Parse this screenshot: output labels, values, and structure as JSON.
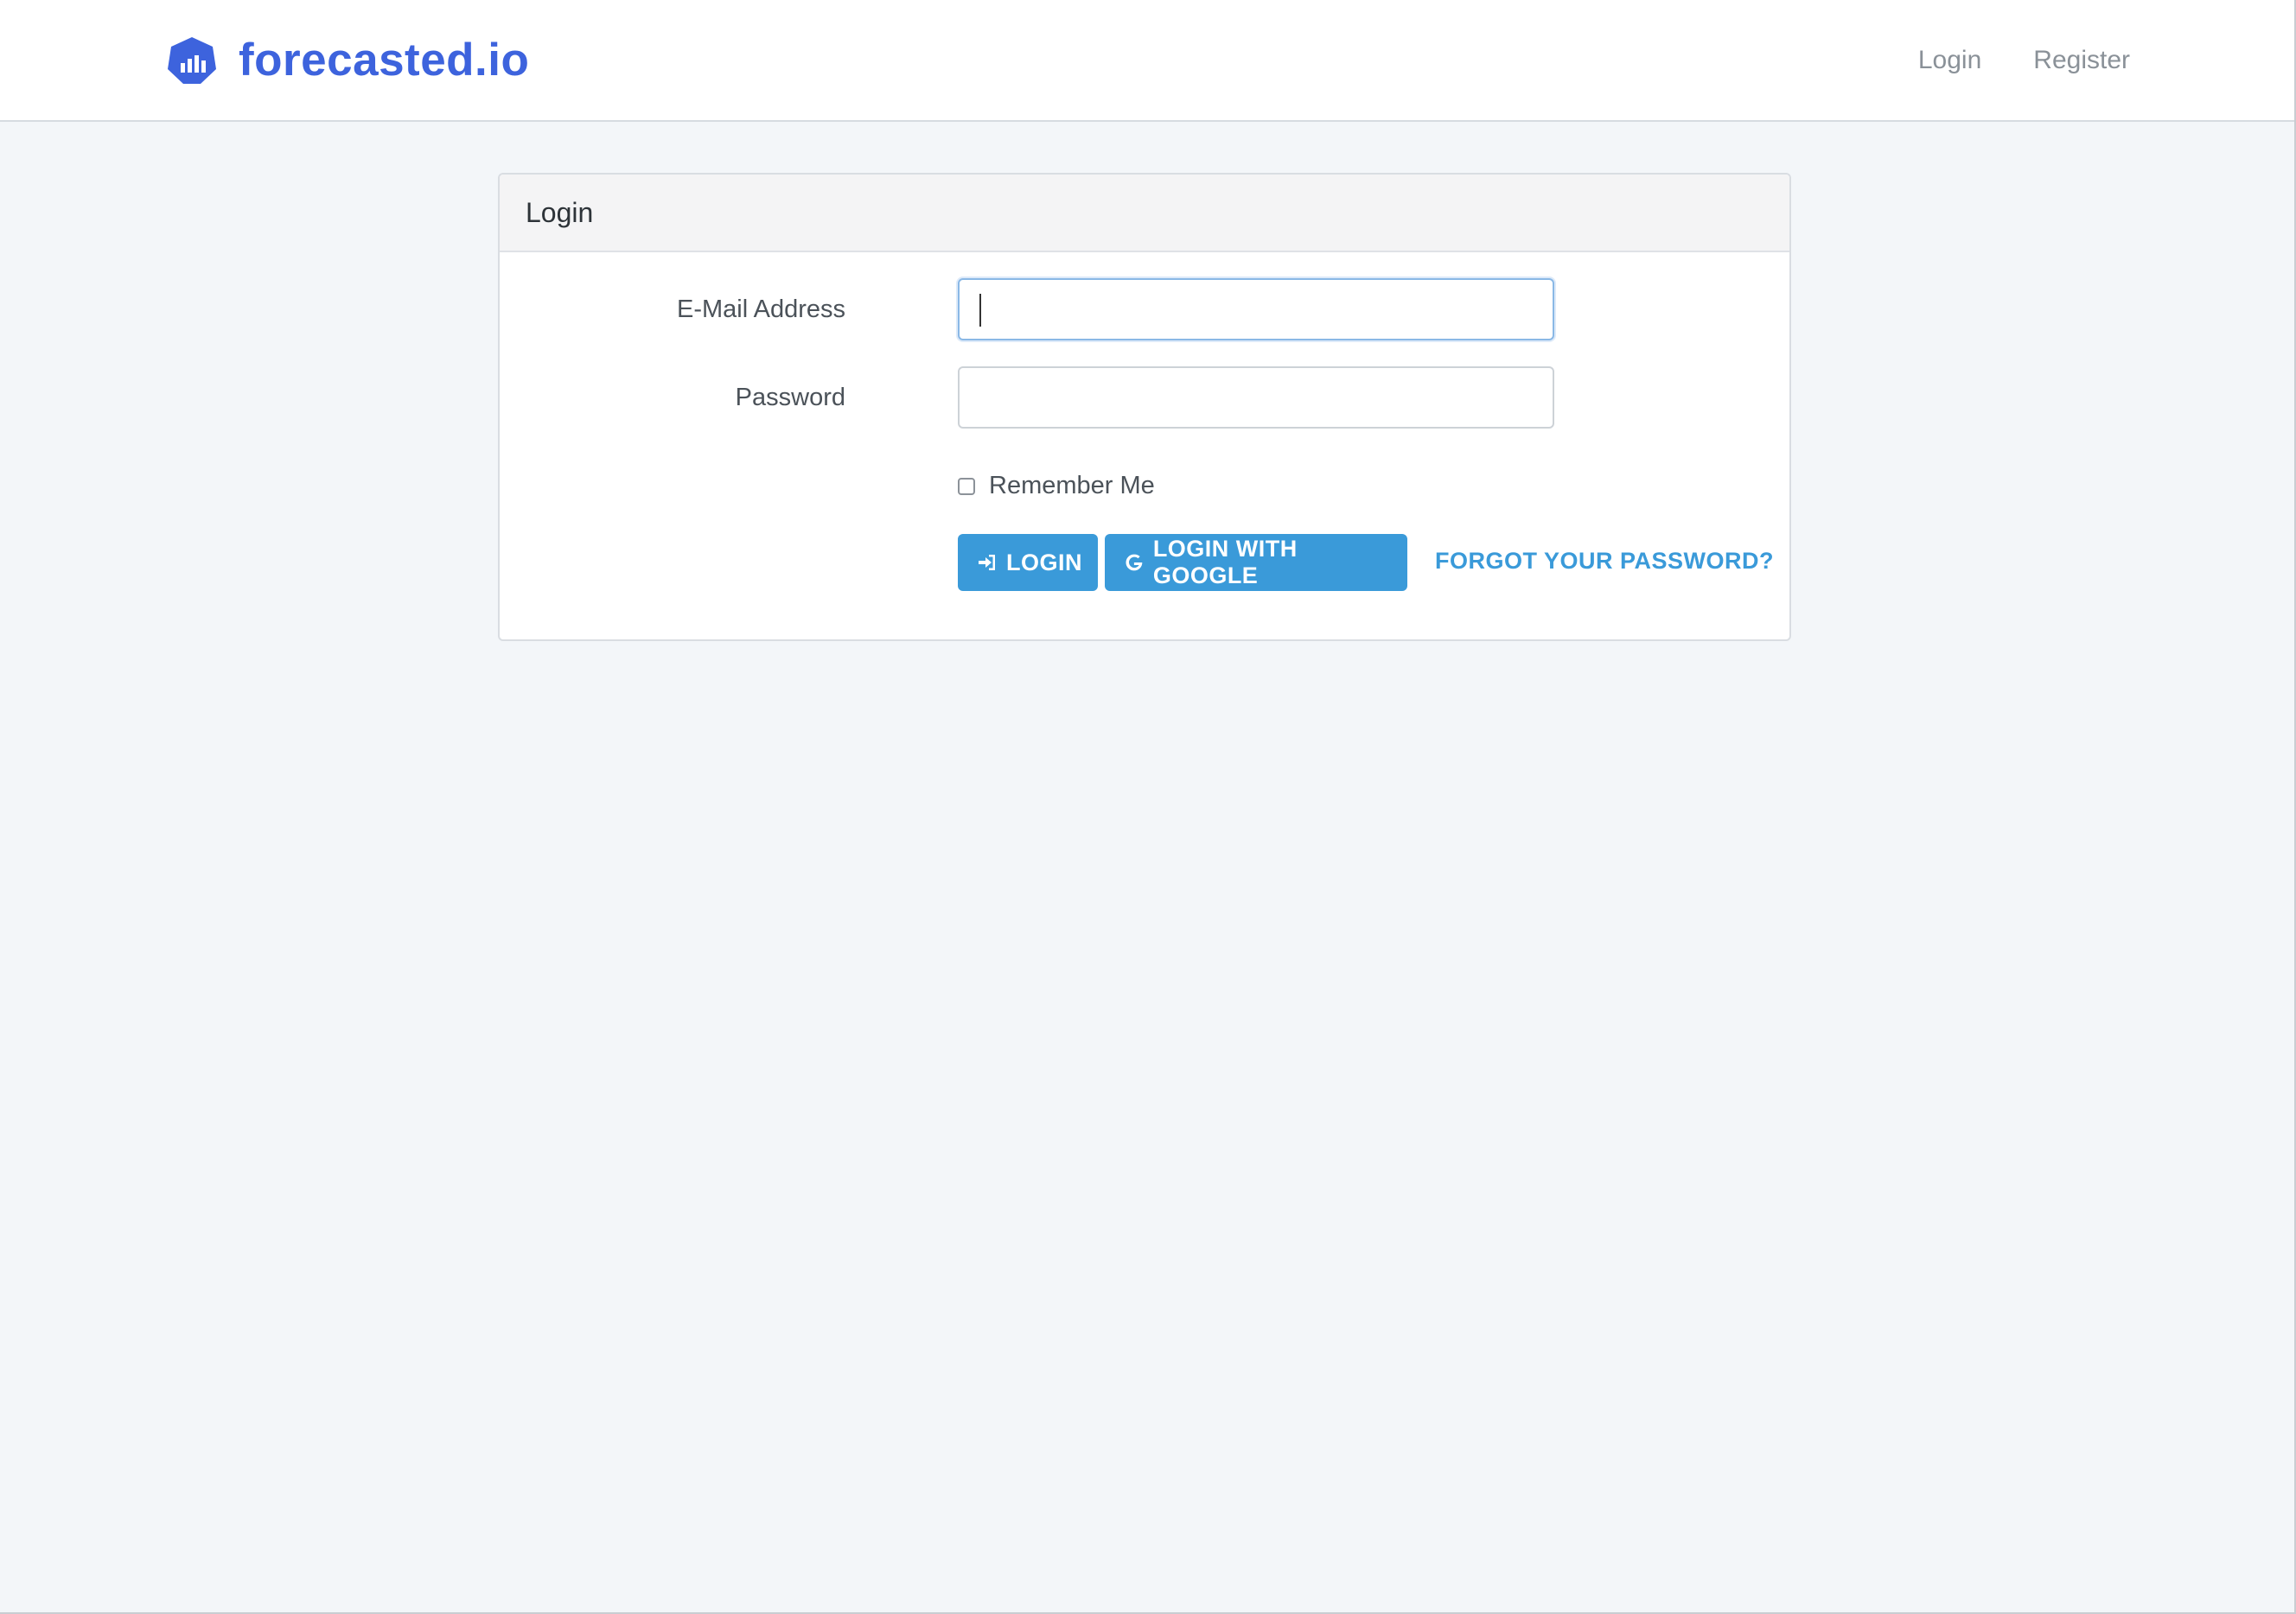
{
  "brand": {
    "name": "forecasted.io",
    "logo_icon": "bar-chart-hexagon-icon",
    "color": "#3d63dd"
  },
  "nav": {
    "links": [
      {
        "label": "Login"
      },
      {
        "label": "Register"
      }
    ]
  },
  "card": {
    "title": "Login",
    "email": {
      "label": "E-Mail Address",
      "value": "",
      "placeholder": ""
    },
    "password": {
      "label": "Password",
      "value": "",
      "placeholder": ""
    },
    "remember": {
      "label": "Remember Me",
      "checked": false
    },
    "buttons": {
      "login_label": "LOGIN",
      "login_icon": "sign-in-icon",
      "google_label": "LOGIN WITH GOOGLE",
      "google_icon": "google-g-icon",
      "forgot_label": "FORGOT YOUR PASSWORD?"
    }
  },
  "colors": {
    "accent": "#3a9ad9",
    "background": "#f3f6f9"
  }
}
